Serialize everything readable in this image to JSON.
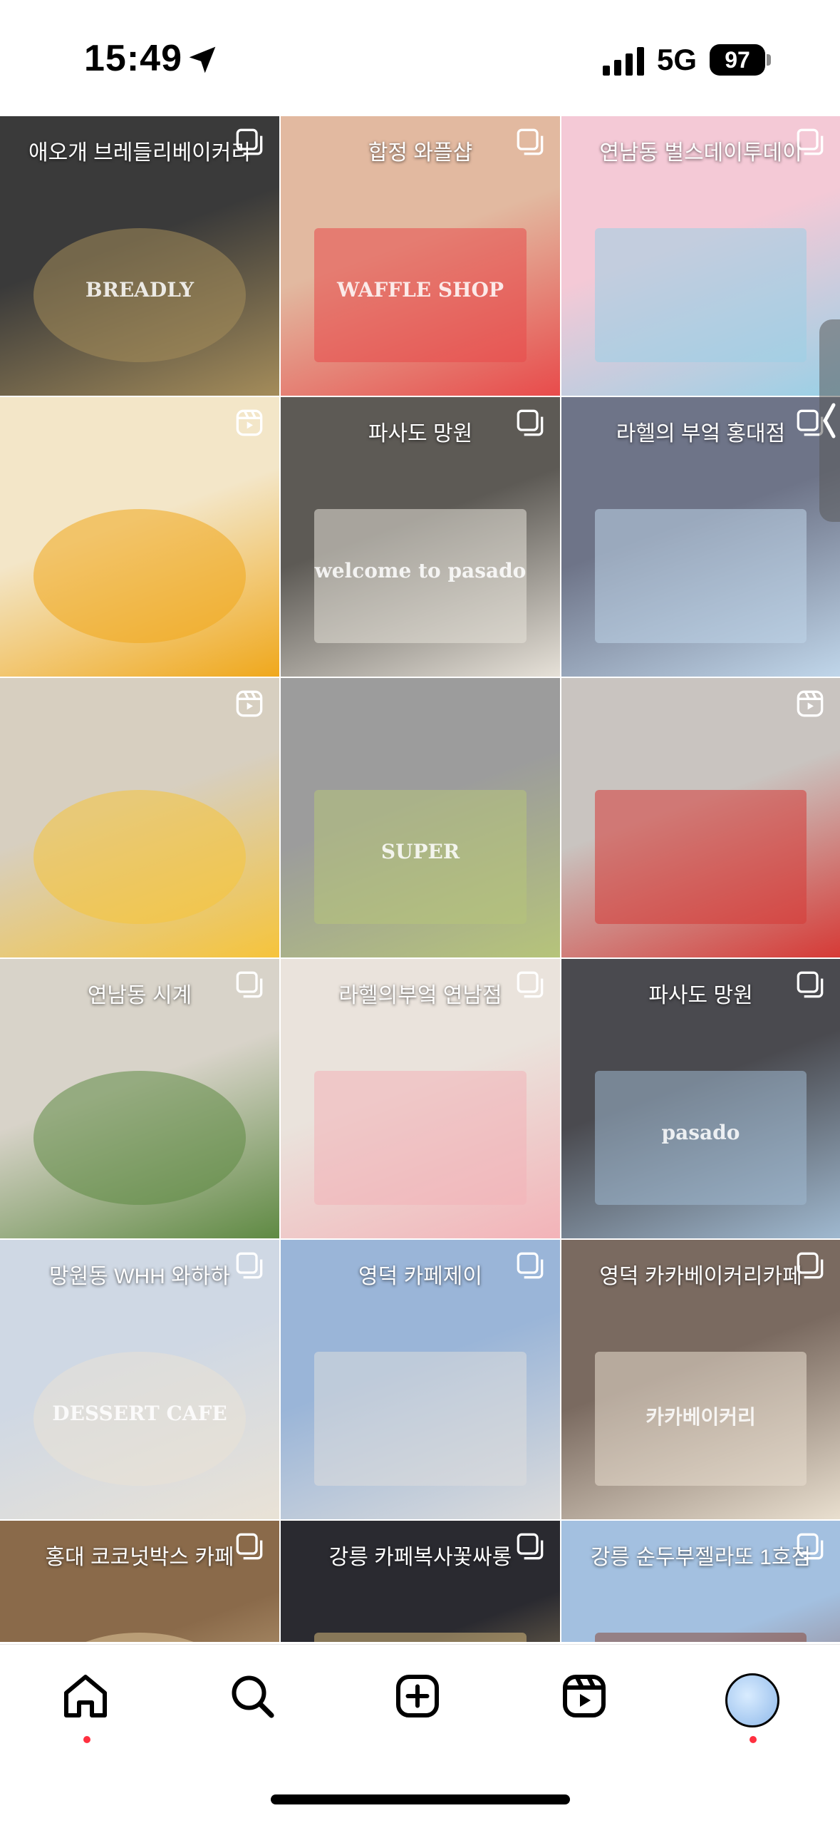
{
  "status": {
    "time": "15:49",
    "network": "5G",
    "battery": "97"
  },
  "grid": {
    "tiles": [
      {
        "caption": "애오개 브레들리베이커리",
        "badge": "multi-post-icon",
        "bg": "#3a3a3a",
        "bg2": "#a48c5a",
        "photo_text": "BREADLY"
      },
      {
        "caption": "합정 와플샵",
        "badge": "multi-post-icon",
        "bg": "#e2b9a0",
        "bg2": "#e84b4b",
        "photo_text": "WAFFLE SHOP"
      },
      {
        "caption": "연남동 벌스데이투데이",
        "badge": "multi-post-icon",
        "bg": "#f4c9d6",
        "bg2": "#9ad0e6",
        "photo_text": ""
      },
      {
        "caption": "",
        "badge": "reels-icon",
        "bg": "#f3e6c8",
        "bg2": "#f0a81c",
        "photo_text": ""
      },
      {
        "caption": "파사도 망원",
        "badge": "multi-post-icon",
        "bg": "#5d5a55",
        "bg2": "#e6e1d8",
        "photo_text": "welcome to pasado"
      },
      {
        "caption": "라헬의 부엌 홍대점",
        "badge": "multi-post-icon",
        "bg": "#6e7488",
        "bg2": "#c0d6ea",
        "photo_text": ""
      },
      {
        "caption": "",
        "badge": "reels-icon",
        "bg": "#d7cfc0",
        "bg2": "#f6c43b",
        "photo_text": ""
      },
      {
        "caption": "",
        "badge": "",
        "bg": "#9c9c9c",
        "bg2": "#b6c47a",
        "photo_text": "SUPER"
      },
      {
        "caption": "",
        "badge": "reels-icon",
        "bg": "#c9c4c0",
        "bg2": "#d63a36",
        "photo_text": ""
      },
      {
        "caption": "연남동 시계",
        "badge": "multi-post-icon",
        "bg": "#d8d3c9",
        "bg2": "#5f8a43",
        "photo_text": ""
      },
      {
        "caption": "라헬의부엌 연남점",
        "badge": "multi-post-icon",
        "bg": "#eae3dc",
        "bg2": "#f3b3b8",
        "photo_text": ""
      },
      {
        "caption": "파사도 망원",
        "badge": "multi-post-icon",
        "bg": "#4a4a4f",
        "bg2": "#9fb8cf",
        "photo_text": "pasado"
      },
      {
        "caption": "망원동 WHH 와하하",
        "badge": "multi-post-icon",
        "bg": "#cfd8e4",
        "bg2": "#e9e2d6",
        "photo_text": "DESSERT CAFE"
      },
      {
        "caption": "영덕 카페제이",
        "badge": "multi-post-icon",
        "bg": "#9ab5d8",
        "bg2": "#dcdcdc",
        "photo_text": ""
      },
      {
        "caption": "영덕 카카베이커리카페",
        "badge": "multi-post-icon",
        "bg": "#7a6a60",
        "bg2": "#e9dfcf",
        "photo_text": "카카베이커리"
      },
      {
        "caption": "홍대 코코넛박스 카페",
        "badge": "multi-post-icon",
        "bg": "#8a6a4a",
        "bg2": "#e0c79a",
        "photo_text": ""
      },
      {
        "caption": "강릉 카페복사꽃싸롱",
        "badge": "multi-post-icon",
        "bg": "#2a2a30",
        "bg2": "#d4b77a",
        "photo_text": ""
      },
      {
        "caption": "강릉 순두부젤라또 1호점",
        "badge": "multi-post-icon",
        "bg": "#a3c0e0",
        "bg2": "#8a4a3a",
        "photo_text": ""
      }
    ]
  },
  "tabbar": {
    "items": [
      "home-icon",
      "search-icon",
      "create-icon",
      "reels-icon",
      "profile-avatar"
    ]
  }
}
